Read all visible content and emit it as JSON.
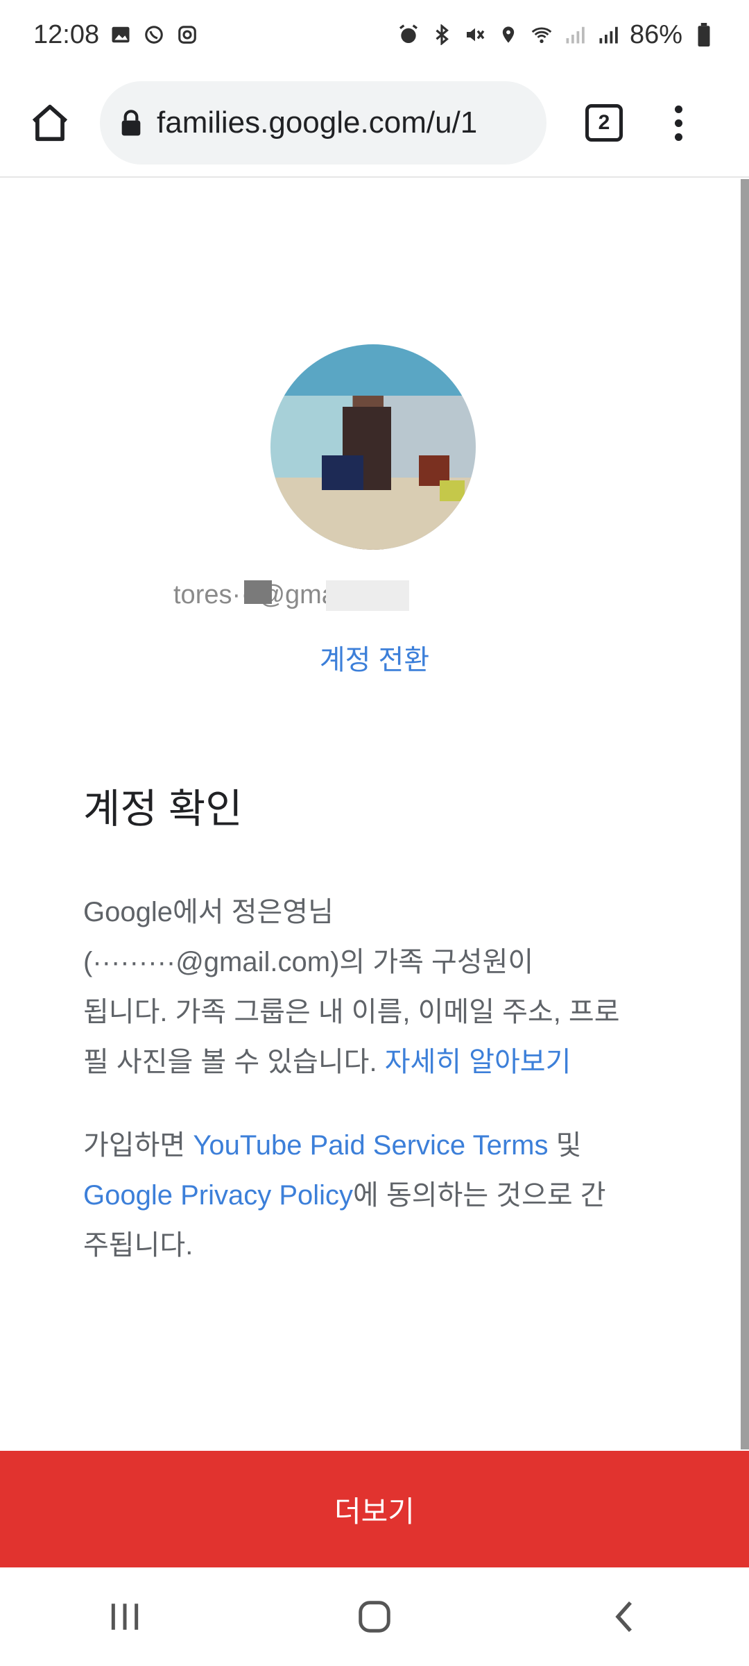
{
  "status_bar": {
    "time": "12:08",
    "battery": "86%",
    "left_icons": [
      "gallery-icon",
      "whatsapp-icon",
      "instagram-icon"
    ],
    "right_icons": [
      "alarm-icon",
      "bluetooth-icon",
      "mute-icon",
      "location-icon",
      "wifi-icon",
      "signal-icon",
      "signal-r-icon",
      "battery-icon"
    ]
  },
  "browser": {
    "url": "families.google.com/u/1",
    "tab_count": "2"
  },
  "account": {
    "email": "tores···@gmail.com",
    "switch_label": "계정 전환"
  },
  "confirm": {
    "heading": "계정 확인",
    "line1": "Google에서 정은영님",
    "line2_email": "(·········@gmail.com)",
    "line2_rest": "의 가족 구성원이",
    "line3": "됩니다. 가족 그룹은 내 이름, 이메일 주소, 프로",
    "line4": "필 사진을 볼 수 있습니다. ",
    "learn_more": "자세히 알아보기"
  },
  "terms": {
    "prefix": "가입하면 ",
    "yt_link": "YouTube Paid Service Terms",
    "and": " 및",
    "privacy_link": "Google Privacy Policy",
    "suffix": "에 동의하는 것으로 간",
    "suffix2": "주됩니다."
  },
  "more_button": "더보기",
  "colors": {
    "accent": "#3c7fd9",
    "button": "#e1332f"
  }
}
